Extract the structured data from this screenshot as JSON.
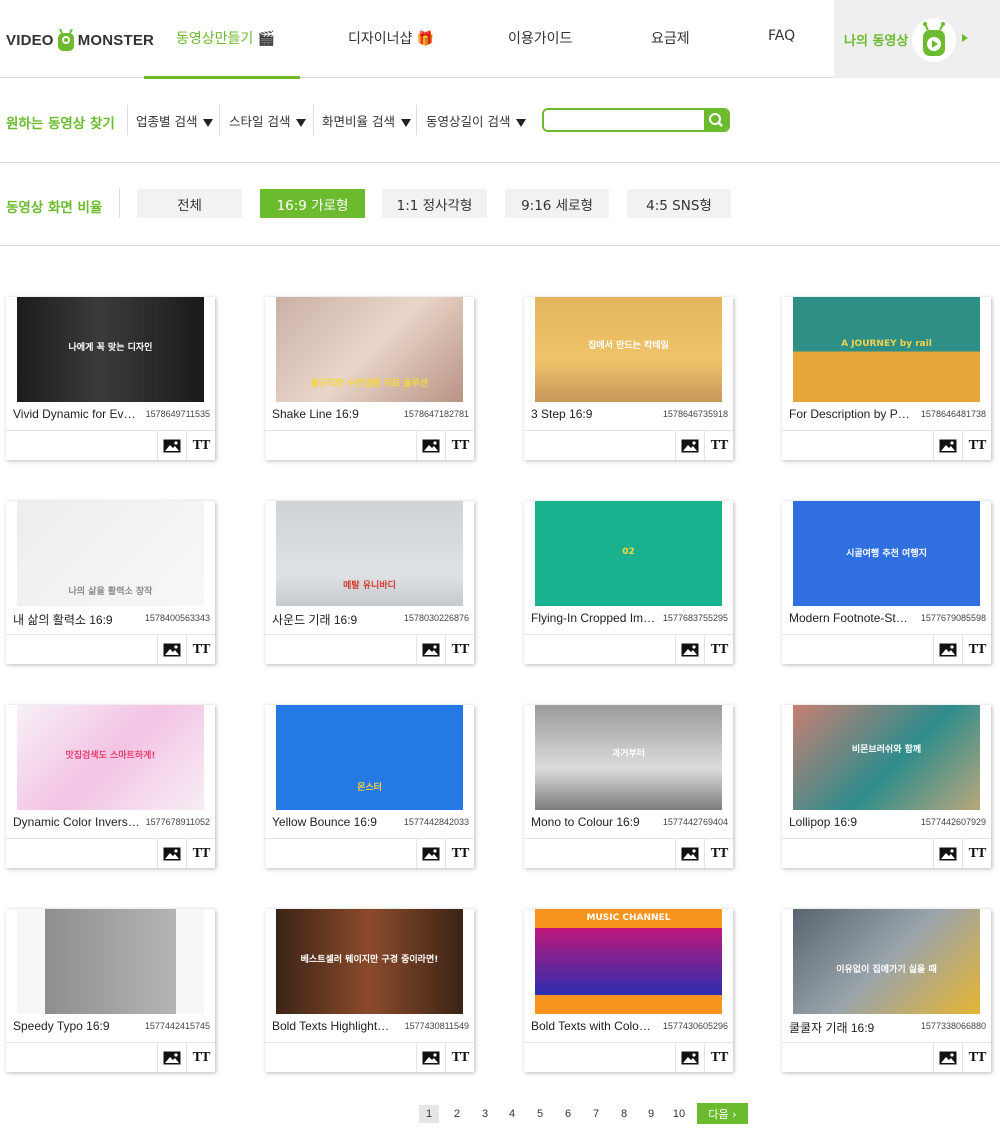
{
  "header": {
    "logo_left": "VIDEO",
    "logo_right": "MONSTER",
    "nav": [
      {
        "label": "동영상만들기 🎬"
      },
      {
        "label": "디자이너샵 🎁"
      },
      {
        "label": "이용가이드"
      },
      {
        "label": "요금제"
      },
      {
        "label": "FAQ"
      }
    ],
    "my_video": "나의 동영상"
  },
  "search": {
    "title": "원하는 동영상 찾기",
    "filters": [
      {
        "label": "업종별 검색"
      },
      {
        "label": "스타일 검색"
      },
      {
        "label": "화면비율 검색"
      },
      {
        "label": "동영상길이 검색"
      }
    ],
    "placeholder": ""
  },
  "ratio": {
    "title": "동영상 화면 비율",
    "options": [
      {
        "label": "전체",
        "active": false
      },
      {
        "label": "16:9 가로형",
        "active": true
      },
      {
        "label": "1:1 정사각형",
        "active": false
      },
      {
        "label": "9:16 세로형",
        "active": false
      },
      {
        "label": "4:5 SNS형",
        "active": false
      }
    ]
  },
  "cards": [
    {
      "title": "Vivid Dynamic for Ev…",
      "id": "1578649711535",
      "caption": "나에게 꼭 맞는 디자인"
    },
    {
      "title": "Shake Line 16:9",
      "id": "1578647182781",
      "caption": "불규칙한 수면생활 치료 솔루션"
    },
    {
      "title": "3 Step 16:9",
      "id": "1578646735918",
      "caption": "집에서 만드는 칵테일"
    },
    {
      "title": "For Description by P…",
      "id": "1578646481738",
      "caption": "A JOURNEY by rail"
    },
    {
      "title": "내 삶의 활력소 16:9",
      "id": "1578400563343",
      "caption": "나의 삶을 활력소 창작"
    },
    {
      "title": "사운드 기래 16:9",
      "id": "1578030226876",
      "caption": "메탈 유니바디"
    },
    {
      "title": "Flying-In Cropped Im…",
      "id": "1577683755295",
      "caption": "02"
    },
    {
      "title": "Modern Footnote-St…",
      "id": "1577679085598",
      "caption": "시골여행 추천 여행지"
    },
    {
      "title": "Dynamic Color Invers…",
      "id": "1577678911052",
      "caption": "맛집검색도 스마트하게!"
    },
    {
      "title": "Yellow Bounce 16:9",
      "id": "1577442842033",
      "caption": "몬스터"
    },
    {
      "title": "Mono to Colour 16:9",
      "id": "1577442769404",
      "caption": "과거부터"
    },
    {
      "title": "Lollipop 16:9",
      "id": "1577442607929",
      "caption": "비몬브러쉬와 함께"
    },
    {
      "title": "Speedy Typo 16:9",
      "id": "1577442415745",
      "caption": ""
    },
    {
      "title": "Bold Texts Highlight…",
      "id": "1577430811549",
      "caption": "베스트셀러 웨이지만 구경 중이라면!"
    },
    {
      "title": "Bold Texts with Colo…",
      "id": "1577430605296",
      "caption": "MUSIC CHANNEL"
    },
    {
      "title": "쿨쿨자 기래 16:9",
      "id": "1577338066880",
      "caption": "이유없이 집에가기 싫을 때"
    }
  ],
  "pagination": {
    "pages": [
      "1",
      "2",
      "3",
      "4",
      "5",
      "6",
      "7",
      "8",
      "9",
      "10"
    ],
    "current": "1",
    "next": "다음 ›"
  }
}
